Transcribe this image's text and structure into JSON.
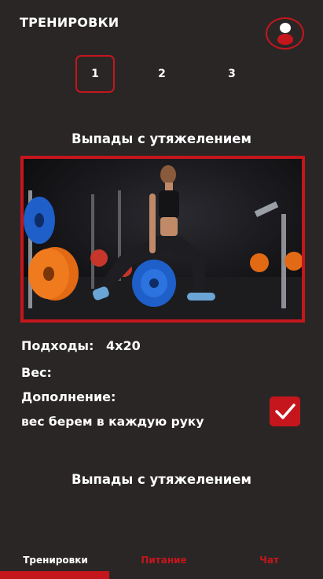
{
  "header": {
    "title": "ТРЕНИРОВКИ",
    "profile_icon": "user-avatar-icon"
  },
  "day_tabs": [
    {
      "label": "1",
      "active": true
    },
    {
      "label": "2",
      "active": false
    },
    {
      "label": "3",
      "active": false
    }
  ],
  "exercises": [
    {
      "title": "Выпады с утяжелением",
      "image": "woman doing weighted lunges with plates in gym",
      "sets_label": "Подходы:",
      "sets_value": "4х20",
      "weight_label": "Вес:",
      "weight_value": "",
      "note_label": "Дополнение:",
      "note_text": "вес берем в каждую руку",
      "completed": true
    },
    {
      "title": "Выпады с утяжелением"
    }
  ],
  "nav": {
    "items": [
      {
        "label": "Тренировки",
        "active": true
      },
      {
        "label": "Питание",
        "active": false
      },
      {
        "label": "Чат",
        "active": false
      }
    ]
  },
  "colors": {
    "accent": "#c4161c",
    "background": "#2b2626",
    "text": "#ffffff"
  }
}
